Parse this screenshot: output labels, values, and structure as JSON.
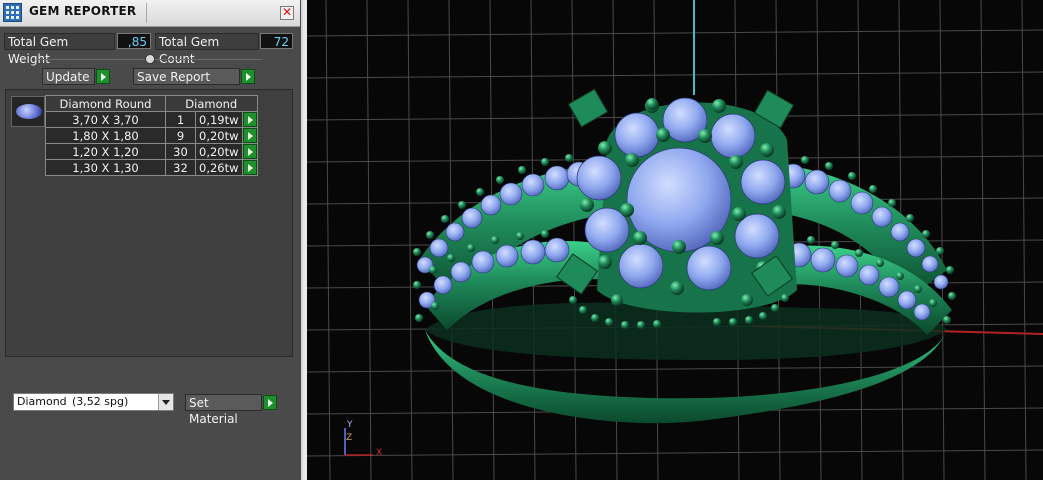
{
  "window": {
    "title": "GEM REPORTER",
    "close_glyph": "✕"
  },
  "stats": {
    "total_weight_label": "Total Gem Weight",
    "total_weight_value": ",85",
    "total_count_label": "Total Gem Count",
    "total_count_value": "72"
  },
  "toolbar": {
    "update_label": "Update",
    "save_label": "Save Report"
  },
  "gem_table": {
    "headers": [
      "Diamond Round",
      "Diamond"
    ],
    "rows": [
      {
        "size": "3,70 X 3,70",
        "count": "1",
        "weight": "0,19tw"
      },
      {
        "size": "1,80 X 1,80",
        "count": "9",
        "weight": "0,20tw"
      },
      {
        "size": "1,20 X 1,20",
        "count": "30",
        "weight": "0,20tw"
      },
      {
        "size": "1,30 X 1,30",
        "count": "32",
        "weight": "0,26tw"
      }
    ]
  },
  "material": {
    "selected": "Diamond",
    "density": "(3,52 spg)",
    "set_label": "Set Material"
  },
  "viewport": {
    "axis_y": "Y",
    "axis_z": "Z",
    "axis_x": "X",
    "colors": {
      "metal": "#1f8a5a",
      "gem": "#8fa8ef",
      "grid": "#5a5a5a",
      "axis_red": "#b22222",
      "axis_cyan": "#43b9c9"
    }
  }
}
